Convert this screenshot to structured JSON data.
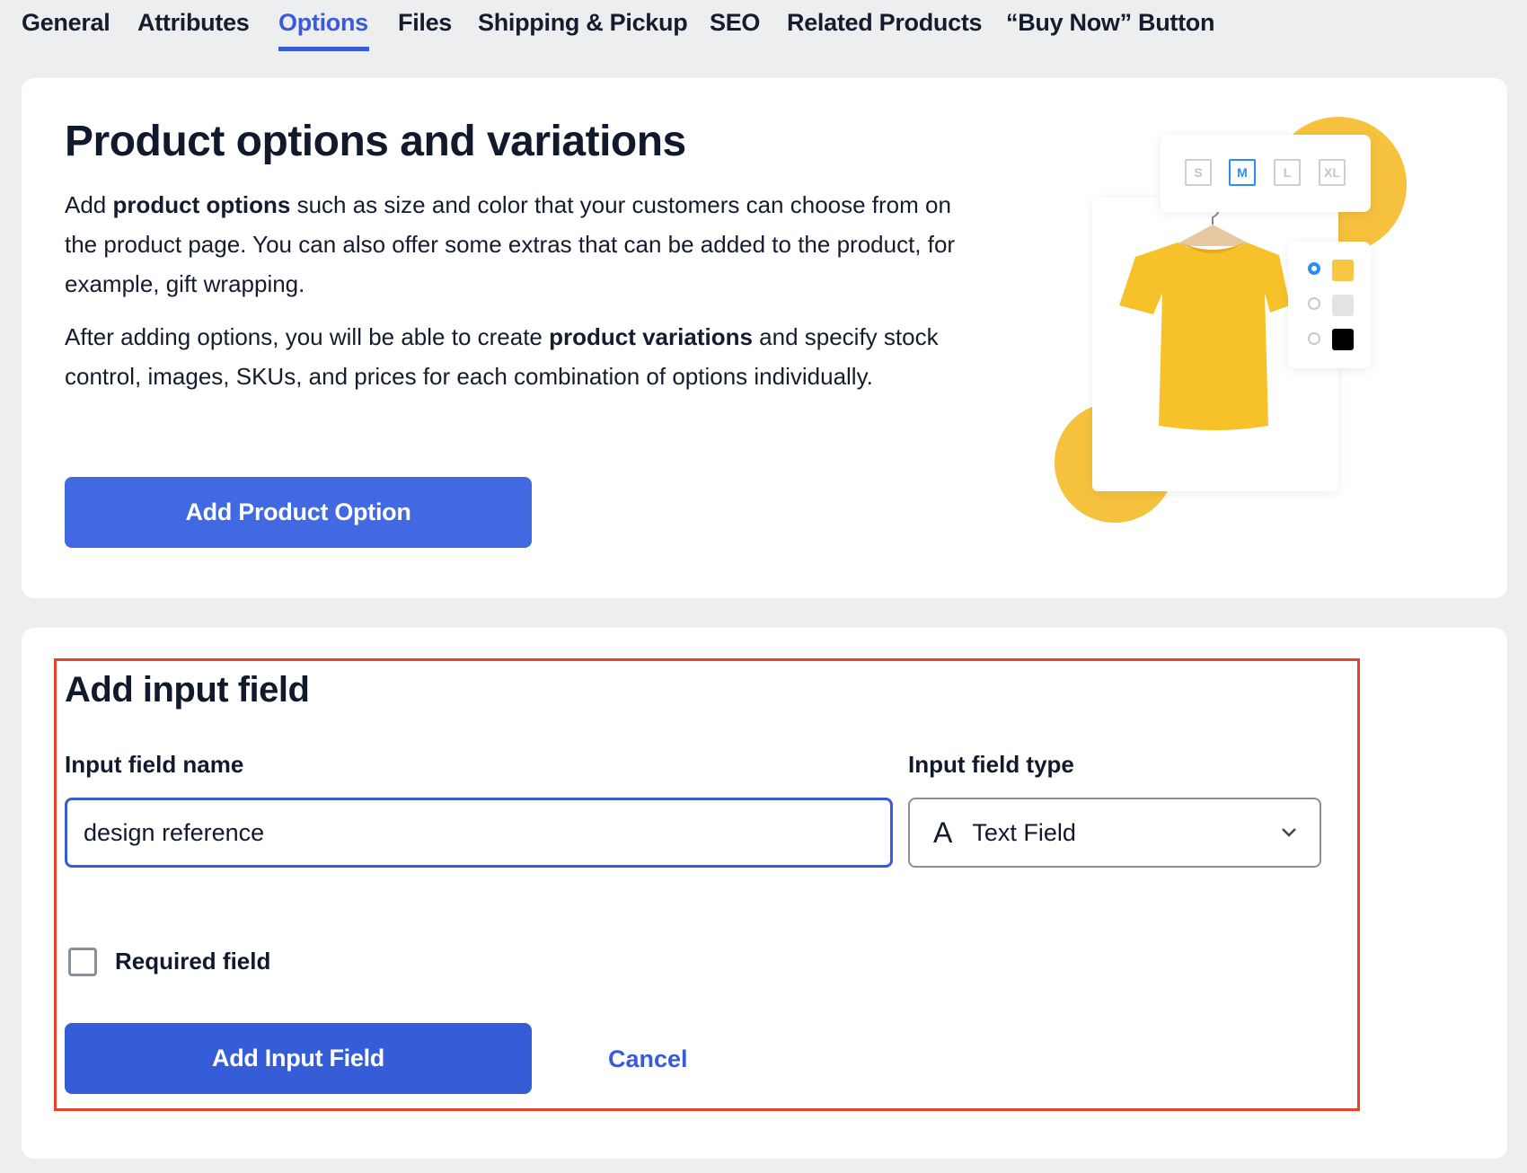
{
  "tabs": [
    {
      "label": "General",
      "active": false
    },
    {
      "label": "Attributes",
      "active": false
    },
    {
      "label": "Options",
      "active": true
    },
    {
      "label": "Files",
      "active": false
    },
    {
      "label": "Shipping & Pickup",
      "active": false
    },
    {
      "label": "SEO",
      "active": false
    },
    {
      "label": "Related Products",
      "active": false
    },
    {
      "label": "“Buy Now” Button",
      "active": false
    }
  ],
  "product_options": {
    "title": "Product options and variations",
    "para1": {
      "before": "Add ",
      "bold": "product options",
      "after": " such as size and color that your customers can choose from on the product page. You can also offer some extras that can be added to the product, for example, gift wrapping."
    },
    "para2": {
      "before": "After adding options, you will be able to create ",
      "bold": "product variations",
      "after": " and specify stock control, images, SKUs, and prices for each combination of options individually."
    },
    "add_button": "Add Product Option",
    "illustration": {
      "sizes": [
        "S",
        "M",
        "L",
        "XL"
      ],
      "selected_size": "M",
      "colors": [
        "#f7c744",
        "#e3e3e3",
        "#000000"
      ],
      "selected_color": "#f7c744"
    }
  },
  "add_input_field": {
    "title": "Add input field",
    "name_label": "Input field name",
    "name_value": "design reference",
    "type_label": "Input field type",
    "type_value": "Text Field",
    "type_icon": "text-letter-a-icon",
    "required_label": "Required field",
    "required_checked": false,
    "submit_button": "Add Input Field",
    "cancel_link": "Cancel"
  },
  "colors": {
    "accent": "#3a5bd9",
    "primary_button": "#4169e1",
    "submit_button": "#365dd8",
    "highlight_border": "#e8412c",
    "illustration_yellow": "#f6c23e"
  }
}
